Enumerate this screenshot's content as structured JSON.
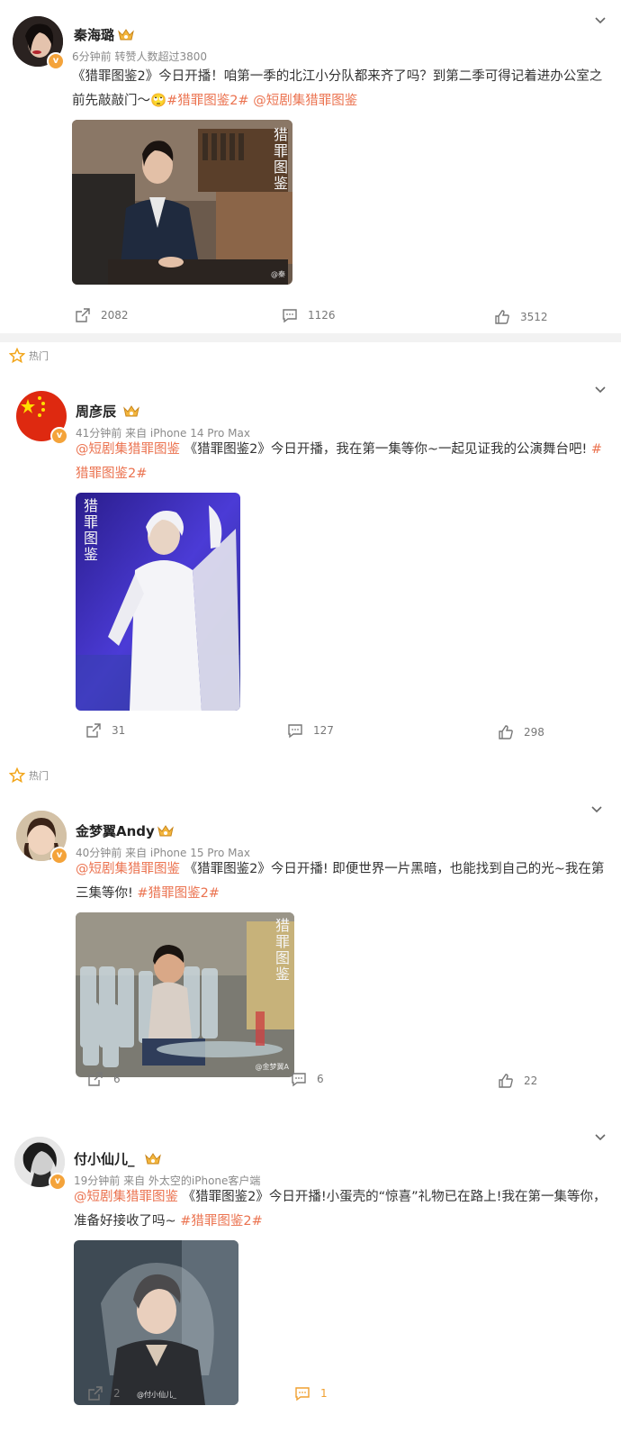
{
  "posts": [
    {
      "user": "秦海璐",
      "meta": "6分钟前 转赞人数超过3800",
      "segments": [
        {
          "text": "《猎罪图鉴2》今日开播！咱第一季的北江小分队都来齐了吗？到第二季可得记着进办公室之前先敲敲门～"
        },
        {
          "text": "🙄"
        },
        {
          "text": "#猎罪图鉴2#",
          "tag": true
        },
        {
          "text": " "
        },
        {
          "text": "@短剧集猎罪图鉴",
          "tag": true
        }
      ],
      "image_overlay": "猎罪图鉴",
      "watermark": "@秦",
      "repost": "2082",
      "comment": "1126",
      "like": "3512"
    },
    {
      "user": "周彦辰",
      "meta": "41分钟前  来自 iPhone 14 Pro Max",
      "segments": [
        {
          "text": "@短剧集猎罪图鉴",
          "tag": true
        },
        {
          "text": " 《猎罪图鉴2》今日开播，我在第一集等你~一起见证我的公演舞台吧! "
        },
        {
          "text": "#猎罪图鉴2#",
          "tag": true
        }
      ],
      "image_overlay": "猎罪图鉴",
      "watermark": "",
      "repost": "31",
      "comment": "127",
      "like": "298"
    },
    {
      "user": "金梦翼Andy",
      "meta": "40分钟前  来自 iPhone 15 Pro Max",
      "segments": [
        {
          "text": "@短剧集猎罪图鉴",
          "tag": true
        },
        {
          "text": " 《猎罪图鉴2》今日开播! 即便世界一片黑暗，也能找到自己的光~我在第三集等你! "
        },
        {
          "text": "#猎罪图鉴2#",
          "tag": true
        }
      ],
      "image_overlay": "猎罪图鉴",
      "watermark": "@金梦翼A",
      "repost": "6",
      "comment": "6",
      "like": "22"
    },
    {
      "user": "付小仙儿_",
      "meta": "19分钟前  来自 外太空的iPhone客户端",
      "segments": [
        {
          "text": "@短剧集猎罪图鉴",
          "tag": true
        },
        {
          "text": " 《猎罪图鉴2》今日开播!小蛋壳的“惊喜”礼物已在路上!我在第一集等你，准备好接收了吗~ "
        },
        {
          "text": "#猎罪图鉴2#",
          "tag": true
        }
      ],
      "image_overlay": "",
      "watermark": "@付小仙儿_",
      "repost": "2",
      "comment": "1",
      "like": ""
    }
  ],
  "hot_label": "热门",
  "colors": {
    "accent": "#eb7350",
    "badge": "#f4a33a",
    "comment_active": "#f0a030"
  }
}
